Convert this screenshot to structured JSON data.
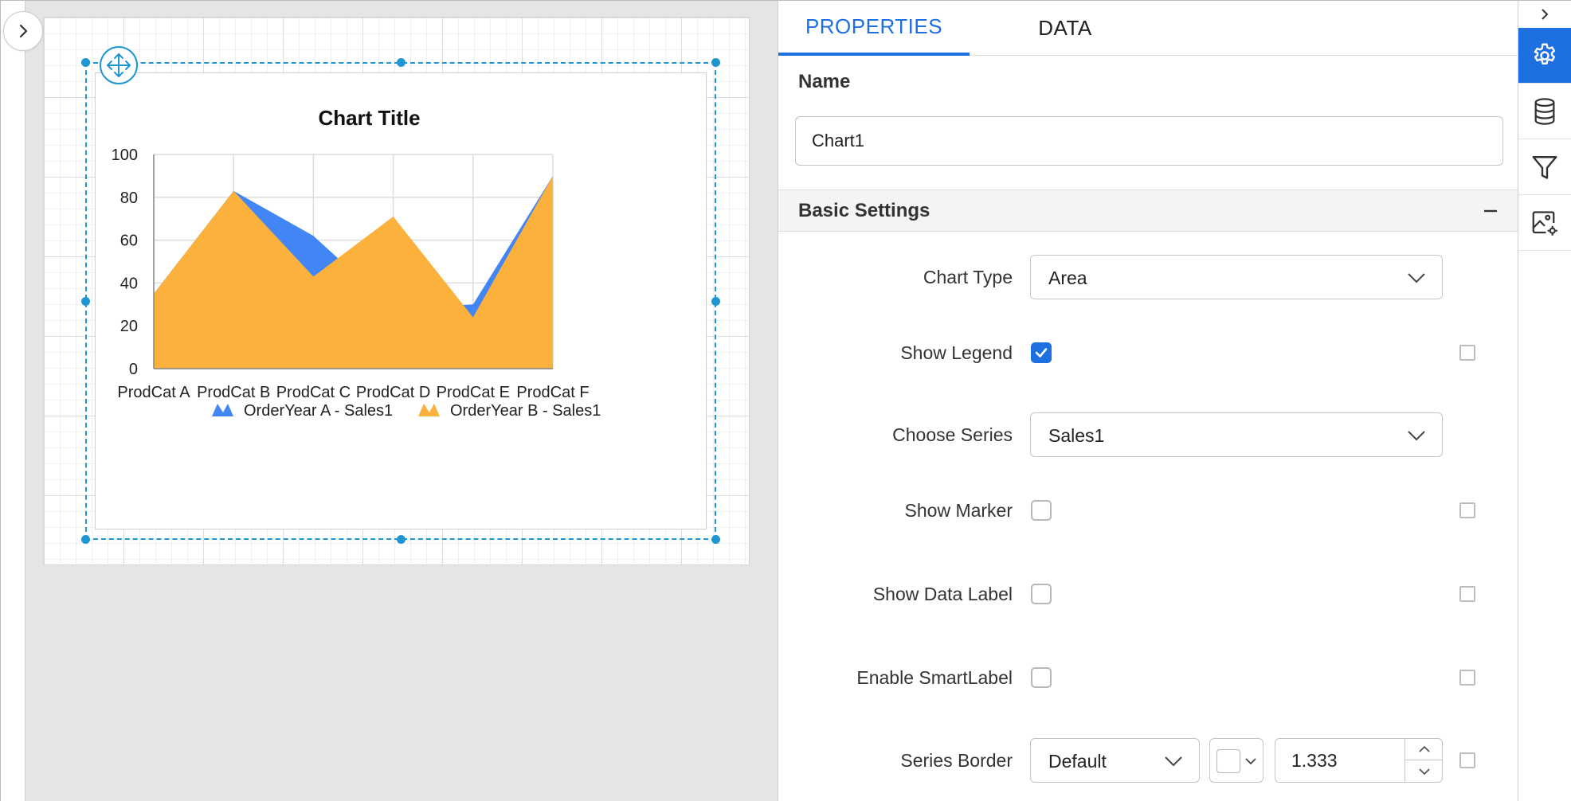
{
  "left_rail": {
    "expand_icon": "chevron-right-icon"
  },
  "tabs": [
    {
      "label": "PROPERTIES",
      "active": true
    },
    {
      "label": "DATA",
      "active": false
    }
  ],
  "name_section": {
    "label": "Name",
    "value": "Chart1"
  },
  "basic_settings": {
    "title": "Basic Settings",
    "collapse_icon": "minus-icon",
    "chart_type": {
      "label": "Chart Type",
      "value": "Area"
    },
    "show_legend": {
      "label": "Show Legend",
      "checked": true
    },
    "choose_series": {
      "label": "Choose Series",
      "value": "Sales1"
    },
    "show_marker": {
      "label": "Show Marker",
      "checked": false
    },
    "show_data_label": {
      "label": "Show Data Label",
      "checked": false
    },
    "enable_smartlabel": {
      "label": "Enable SmartLabel",
      "checked": false
    },
    "series_border": {
      "label": "Series Border",
      "style": "Default",
      "color": "#ffffff",
      "width": "1.333"
    }
  },
  "icon_bar": {
    "items": [
      {
        "icon": "gear-icon",
        "active": true
      },
      {
        "icon": "database-icon",
        "active": false
      },
      {
        "icon": "filter-icon",
        "active": false
      },
      {
        "icon": "image-settings-icon",
        "active": false
      }
    ]
  },
  "colors": {
    "accent": "#1e6fe0",
    "selection": "#1e96d2",
    "series_a": "#4285f4",
    "series_b": "#fbb13c"
  },
  "chart_data": {
    "type": "area",
    "title": "Chart Title",
    "categories": [
      "ProdCat A",
      "ProdCat B",
      "ProdCat C",
      "ProdCat D",
      "ProdCat E",
      "ProdCat F"
    ],
    "series": [
      {
        "name": "OrderYear A - Sales1",
        "color": "#4285f4",
        "values": [
          35,
          83,
          62,
          28,
          30,
          90
        ]
      },
      {
        "name": "OrderYear B - Sales1",
        "color": "#fbb13c",
        "values": [
          35,
          83,
          43,
          71,
          24,
          90
        ]
      }
    ],
    "y_ticks": [
      "0",
      "20",
      "40",
      "60",
      "80",
      "100"
    ],
    "ylim": [
      0,
      100
    ],
    "legend_position": "bottom",
    "grid": true
  }
}
